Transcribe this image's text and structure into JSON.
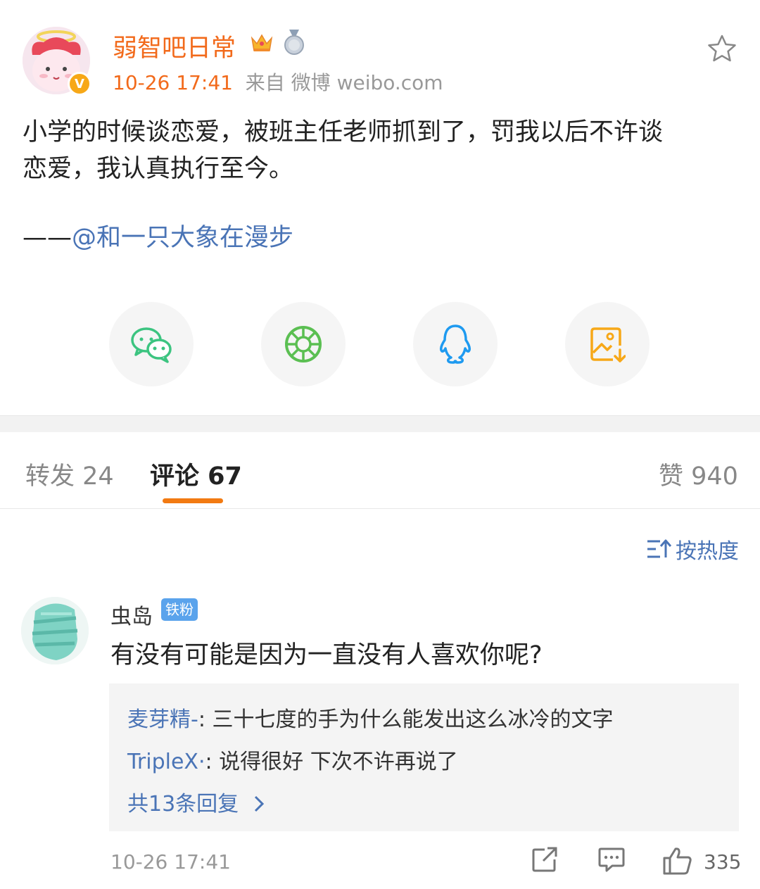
{
  "post": {
    "author": "弱智吧日常",
    "time": "10-26 17:41",
    "source": "来自 微博 weibo.com",
    "text_line1": "小学的时候谈恋爱，被班主任老师抓到了，罚我以后不许谈",
    "text_line2": "恋爱，我认真执行至今。",
    "signature_dash": "——",
    "signature_mention": "@和一只大象在漫步"
  },
  "share": {
    "items": [
      "wechat-icon",
      "moments-icon",
      "qq-icon",
      "save-image-icon"
    ],
    "colors": {
      "wechat": "#3cc480",
      "moments": "#5bbf52",
      "qq": "#1e9af0",
      "save": "#f7a818"
    }
  },
  "tabs": {
    "repost": "转发 24",
    "comments": "评论 67",
    "likes": "赞 940",
    "active_underline_color": "#f27a12"
  },
  "sort": {
    "label": "按热度"
  },
  "comment": {
    "author": "虫岛",
    "badge": "铁粉",
    "text": "有没有可能是因为一直没有人喜欢你呢?",
    "time": "10-26 17:41",
    "like_count": "335",
    "replies": [
      {
        "author": "麦芽精-",
        "text": ": 三十七度的手为什么能发出这么冰冷的文字"
      },
      {
        "author": "TripleX·",
        "text": ": 说得很好 下次不许再说了"
      }
    ],
    "more_replies": "共13条回复"
  },
  "colors": {
    "accent": "#f26a1b",
    "link": "#4a74b6",
    "meta": "#999999"
  }
}
